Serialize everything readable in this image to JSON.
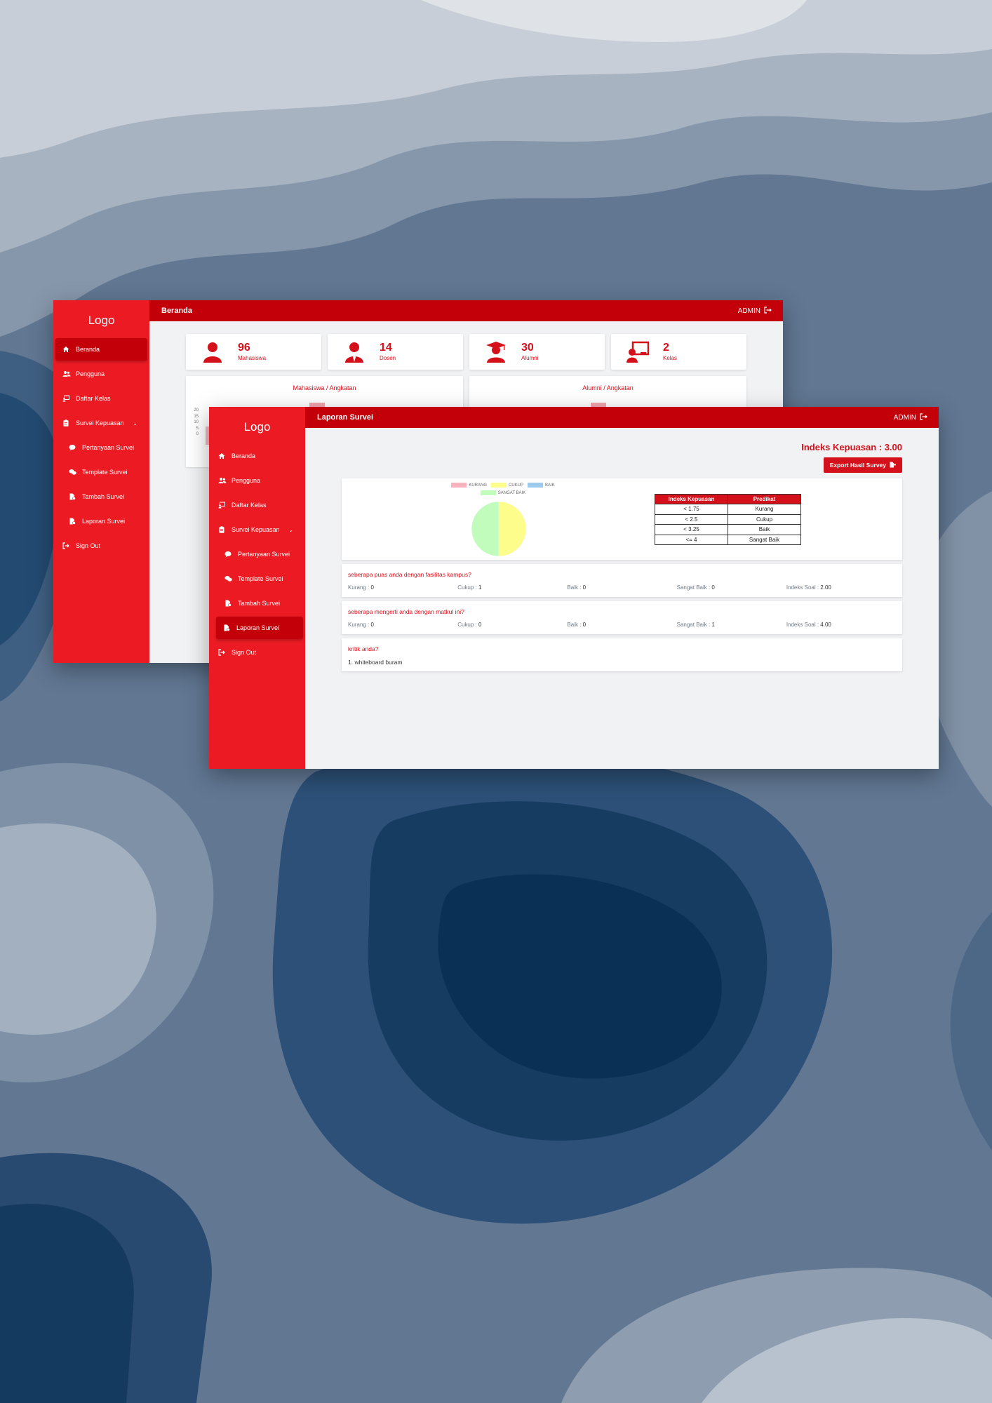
{
  "back_window": {
    "logo": "Logo",
    "title": "Beranda",
    "admin": "ADMIN",
    "sidebar": [
      {
        "label": "Beranda",
        "icon": "home-icon"
      },
      {
        "label": "Pengguna",
        "icon": "users-icon"
      },
      {
        "label": "Daftar Kelas",
        "icon": "class-list-icon"
      },
      {
        "label": "Survei Kepuasan",
        "icon": "clipboard-icon"
      },
      {
        "label": "Pertanyaan Survei",
        "icon": "comment-icon"
      },
      {
        "label": "Template Survei",
        "icon": "comments-icon"
      },
      {
        "label": "Tambah Survei",
        "icon": "file-add-icon"
      },
      {
        "label": "Laporan Survei",
        "icon": "file-report-icon"
      },
      {
        "label": "Sign Out",
        "icon": "sign-out-icon"
      }
    ],
    "stats": [
      {
        "value": "96",
        "label": "Mahasiswa",
        "icon": "user-icon"
      },
      {
        "value": "14",
        "label": "Dosen",
        "icon": "user-tie-icon"
      },
      {
        "value": "30",
        "label": "Alumni",
        "icon": "graduate-icon"
      },
      {
        "value": "2",
        "label": "Kelas",
        "icon": "chalkboard-teacher-icon"
      }
    ],
    "charts": [
      {
        "title": "Mahasiswa / Angkatan",
        "y_ticks": [
          "20",
          "15",
          "10",
          "5",
          "0"
        ]
      },
      {
        "title": "Alumni / Angkatan"
      }
    ]
  },
  "front_window": {
    "logo": "Logo",
    "title": "Laporan Survei",
    "admin": "ADMIN",
    "sidebar": [
      {
        "label": "Beranda",
        "icon": "home-icon"
      },
      {
        "label": "Pengguna",
        "icon": "users-icon"
      },
      {
        "label": "Daftar Kelas",
        "icon": "class-list-icon"
      },
      {
        "label": "Survei Kepuasan",
        "icon": "clipboard-icon"
      },
      {
        "label": "Pertanyaan Survei",
        "icon": "comment-icon"
      },
      {
        "label": "Template Survei",
        "icon": "comments-icon"
      },
      {
        "label": "Tambah Survei",
        "icon": "file-add-icon"
      },
      {
        "label": "Laporan Survei",
        "icon": "file-report-icon"
      },
      {
        "label": "Sign Out",
        "icon": "sign-out-icon"
      }
    ],
    "index_label": "Indeks Kepuasan : 3.00",
    "export_label": "Export Hasil Survey",
    "table": {
      "headers": [
        "Indeks Kepuasan",
        "Predikat"
      ],
      "rows": [
        [
          "< 1.75",
          "Kurang"
        ],
        [
          "< 2.5",
          "Cukup"
        ],
        [
          "< 3.25",
          "Baik"
        ],
        [
          "<= 4",
          "Sangat Baik"
        ]
      ]
    },
    "questions": [
      {
        "text": "seberapa puas anda dengan fasilitas kampus?",
        "kurang": "0",
        "cukup": "1",
        "baik": "0",
        "sangat_baik": "0",
        "indeks": "2.00"
      },
      {
        "text": "seberapa mengerti anda dengan matkul ini?",
        "kurang": "0",
        "cukup": "0",
        "baik": "0",
        "sangat_baik": "1",
        "indeks": "4.00"
      }
    ],
    "stat_labels": {
      "kurang": "Kurang : ",
      "cukup": "Cukup : ",
      "baik": "Baik : ",
      "sangat_baik": "Sangat Baik : ",
      "indeks": "Indeks Soal : "
    },
    "critique": {
      "title": "kritik anda?",
      "answer": "1. whiteboard buram"
    }
  },
  "chart_data": {
    "type": "pie",
    "categories": [
      "KURANG",
      "CUKUP",
      "BAIK",
      "SANGAT BAIK"
    ],
    "values": [
      0,
      1,
      0,
      1
    ],
    "colors": [
      "#f7b3be",
      "#fcfd8b",
      "#9ccbee",
      "#c2fcbd"
    ],
    "legend": "top"
  },
  "colors": {
    "primary": "#ec1b23",
    "primary_dark": "#c3000a",
    "text_red": "#d4111b"
  }
}
